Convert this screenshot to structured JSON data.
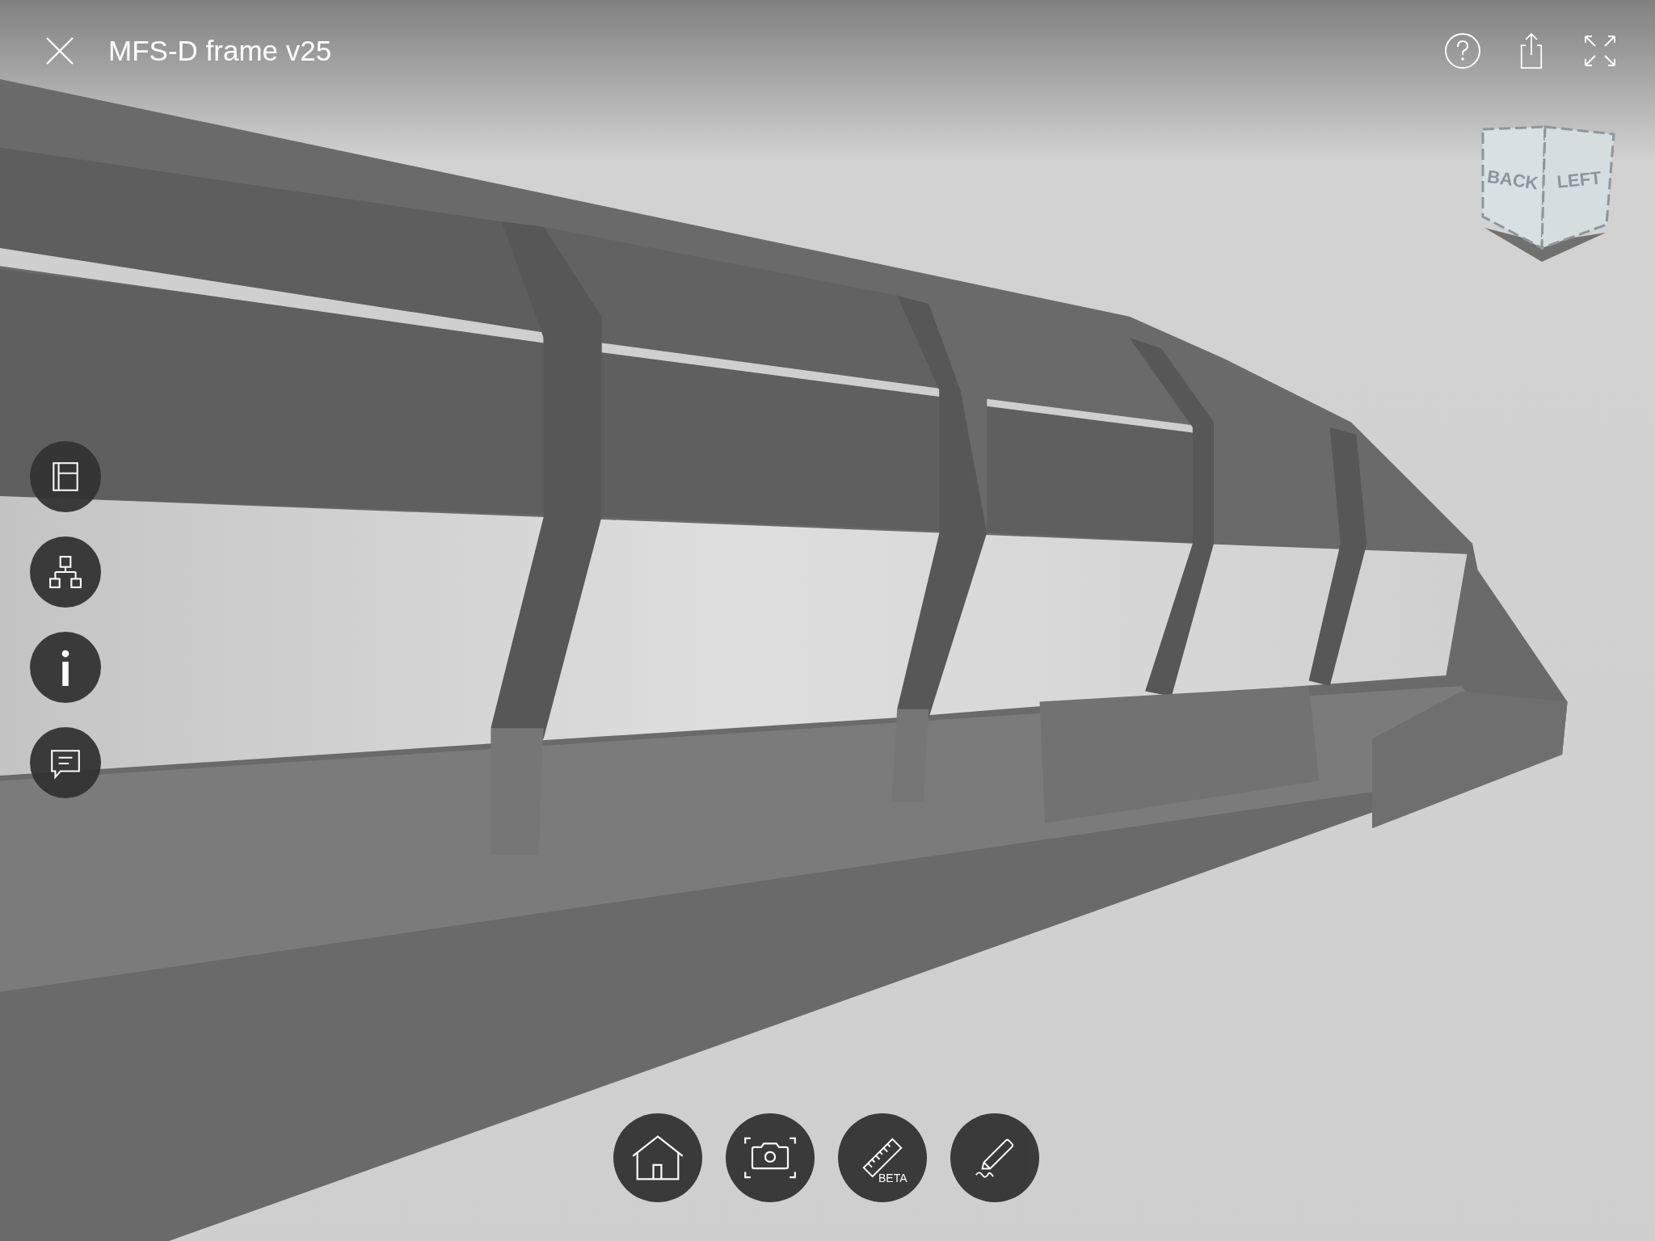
{
  "title": "MFS-D frame v25",
  "top_actions": [
    {
      "kind": "help"
    },
    {
      "kind": "share"
    },
    {
      "kind": "fullscreen"
    }
  ],
  "view_cube": {
    "faces": [
      "BACK",
      "LEFT"
    ]
  },
  "side_tools": [
    {
      "kind": "panels"
    },
    {
      "kind": "hierarchy"
    },
    {
      "kind": "info"
    },
    {
      "kind": "comments"
    }
  ],
  "bottom_tools": [
    {
      "kind": "home"
    },
    {
      "kind": "screenshot"
    },
    {
      "kind": "measure",
      "badge": "BETA"
    },
    {
      "kind": "markup"
    }
  ]
}
